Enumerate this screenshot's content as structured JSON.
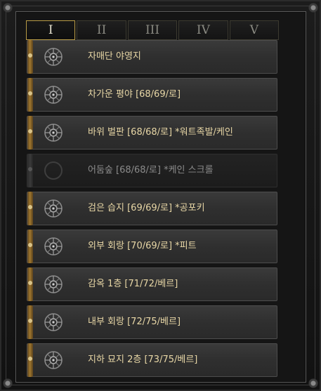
{
  "tabs": [
    {
      "label": "I",
      "active": true
    },
    {
      "label": "II",
      "active": false
    },
    {
      "label": "III",
      "active": false
    },
    {
      "label": "IV",
      "active": false
    },
    {
      "label": "V",
      "active": false
    }
  ],
  "entries": [
    {
      "label": "자매단 야영지",
      "locked": false
    },
    {
      "label": "차가운 평야 [68/69/로]",
      "locked": false
    },
    {
      "label": "바위 벌판 [68/68/로] *워트족발/케인",
      "locked": false
    },
    {
      "label": "어둠숲 [68/68/로] *케인 스크롤",
      "locked": true
    },
    {
      "label": "검은 습지 [69/69/로] *공포키",
      "locked": false
    },
    {
      "label": "외부 회랑 [70/69/로] *피트",
      "locked": false
    },
    {
      "label": "감옥 1층 [71/72/베르]",
      "locked": false
    },
    {
      "label": "내부 회랑 [72/75/베르]",
      "locked": false
    },
    {
      "label": "지하 묘지 2층 [73/75/베르]",
      "locked": false
    }
  ],
  "colors": {
    "active_tab_border": "#b79a45",
    "label_gold": "#e8d7a6",
    "label_dim": "#8b8b8b"
  },
  "icons": {
    "waypoint": "waypoint-rune-icon",
    "locked": "empty-circle-icon"
  }
}
